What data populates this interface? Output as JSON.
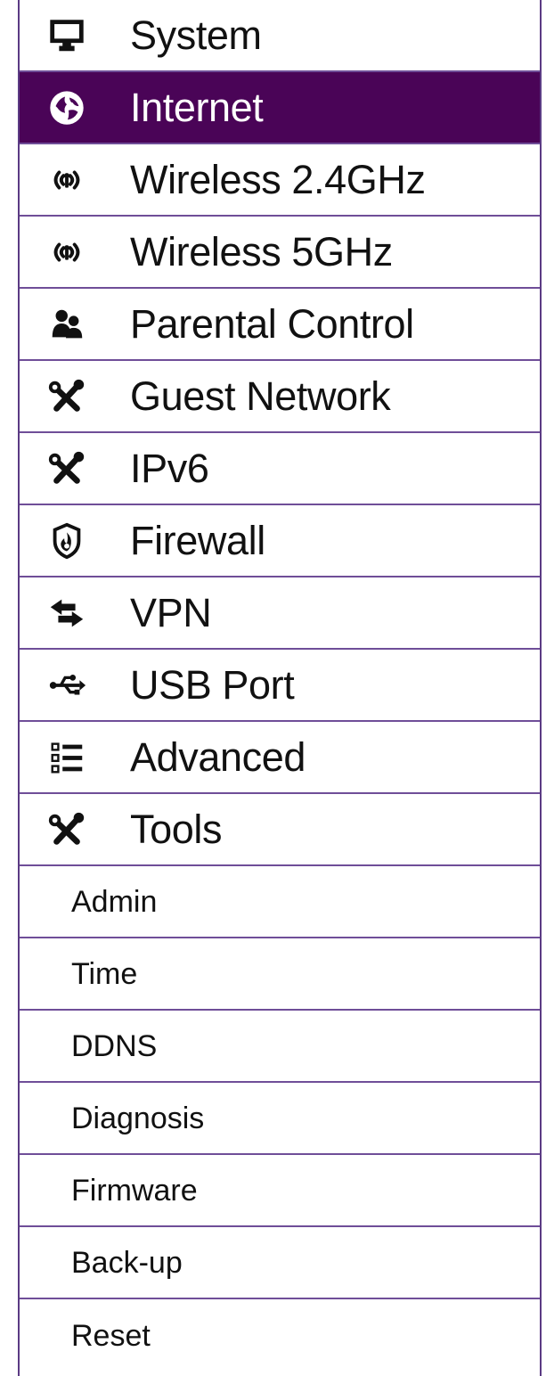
{
  "menu": {
    "items": [
      {
        "label": "System",
        "icon": "monitor-icon",
        "active": false
      },
      {
        "label": "Internet",
        "icon": "globe-icon",
        "active": true
      },
      {
        "label": "Wireless 2.4GHz",
        "icon": "wireless-icon",
        "active": false
      },
      {
        "label": "Wireless 5GHz",
        "icon": "wireless-icon",
        "active": false
      },
      {
        "label": "Parental Control",
        "icon": "users-icon",
        "active": false
      },
      {
        "label": "Guest Network",
        "icon": "tools-icon",
        "active": false
      },
      {
        "label": "IPv6",
        "icon": "tools-icon",
        "active": false
      },
      {
        "label": "Firewall",
        "icon": "shield-fire-icon",
        "active": false
      },
      {
        "label": "VPN",
        "icon": "exchange-arrows-icon",
        "active": false
      },
      {
        "label": "USB Port",
        "icon": "usb-icon",
        "active": false
      },
      {
        "label": "Advanced",
        "icon": "list-icon",
        "active": false
      },
      {
        "label": "Tools",
        "icon": "tools-icon",
        "active": false
      }
    ],
    "subitems": [
      {
        "label": "Admin"
      },
      {
        "label": "Time"
      },
      {
        "label": "DDNS"
      },
      {
        "label": "Diagnosis"
      },
      {
        "label": "Firmware"
      },
      {
        "label": "Back-up"
      },
      {
        "label": "Reset"
      }
    ]
  },
  "colors": {
    "active_background": "#4a0457",
    "border": "#6f4e98",
    "text": "#111111",
    "active_text": "#ffffff"
  }
}
